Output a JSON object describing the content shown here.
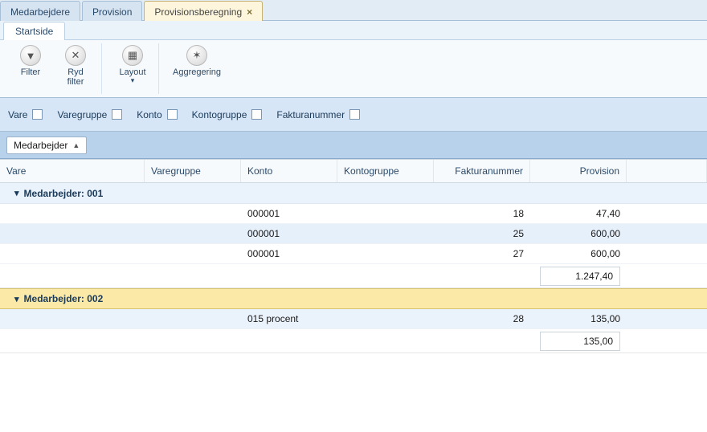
{
  "tabs": {
    "t0": "Medarbejdere",
    "t1": "Provision",
    "t2": "Provisionsberegning"
  },
  "ribbon": {
    "tab": "Startside",
    "filter": "Filter",
    "clear": "Ryd\nfilter",
    "layout": "Layout",
    "agg": "Aggregering"
  },
  "filters": {
    "vare": "Vare",
    "varegruppe": "Varegruppe",
    "konto": "Konto",
    "kontogruppe": "Kontogruppe",
    "fakturanummer": "Fakturanummer"
  },
  "groupby": "Medarbejder",
  "columns": {
    "vare": "Vare",
    "varegruppe": "Varegruppe",
    "konto": "Konto",
    "kontogruppe": "Kontogruppe",
    "fakturanummer": "Fakturanummer",
    "provision": "Provision"
  },
  "groups": [
    {
      "label": "Medarbejder: 001",
      "rows": [
        {
          "vare": "",
          "varegruppe": "",
          "konto": "000001",
          "kontogruppe": "",
          "fnr": "18",
          "prov": "47,40"
        },
        {
          "vare": "",
          "varegruppe": "",
          "konto": "000001",
          "kontogruppe": "",
          "fnr": "25",
          "prov": "600,00"
        },
        {
          "vare": "",
          "varegruppe": "",
          "konto": "000001",
          "kontogruppe": "",
          "fnr": "27",
          "prov": "600,00"
        }
      ],
      "subtotal": "1.247,40"
    },
    {
      "label": "Medarbejder: 002",
      "rows": [
        {
          "vare": "",
          "varegruppe": "",
          "konto": "015 procent",
          "kontogruppe": "",
          "fnr": "28",
          "prov": "135,00"
        }
      ],
      "subtotal": "135,00"
    }
  ]
}
